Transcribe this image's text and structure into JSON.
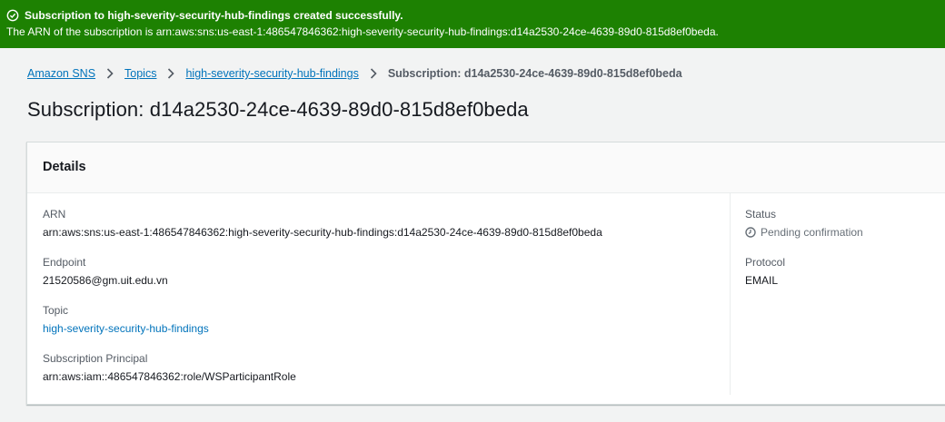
{
  "flash": {
    "title": "Subscription to high-severity-security-hub-findings created successfully.",
    "message": "The ARN of the subscription is arn:aws:sns:us-east-1:486547846362:high-severity-security-hub-findings:d14a2530-24ce-4639-89d0-815d8ef0beda.",
    "icon": "check-circle-icon",
    "color": "#1d8102"
  },
  "breadcrumb": {
    "items": [
      "Amazon SNS",
      "Topics",
      "high-severity-security-hub-findings"
    ],
    "current": "Subscription: d14a2530-24ce-4639-89d0-815d8ef0beda"
  },
  "page": {
    "title": "Subscription: d14a2530-24ce-4639-89d0-815d8ef0beda"
  },
  "details": {
    "heading": "Details",
    "arn_label": "ARN",
    "arn_value": "arn:aws:sns:us-east-1:486547846362:high-severity-security-hub-findings:d14a2530-24ce-4639-89d0-815d8ef0beda",
    "endpoint_label": "Endpoint",
    "endpoint_value": "21520586@gm.uit.edu.vn",
    "topic_label": "Topic",
    "topic_value": "high-severity-security-hub-findings",
    "principal_label": "Subscription Principal",
    "principal_value": "arn:aws:iam::486547846362:role/WSParticipantRole",
    "status_label": "Status",
    "status_value": "Pending confirmation",
    "protocol_label": "Protocol",
    "protocol_value": "EMAIL"
  }
}
